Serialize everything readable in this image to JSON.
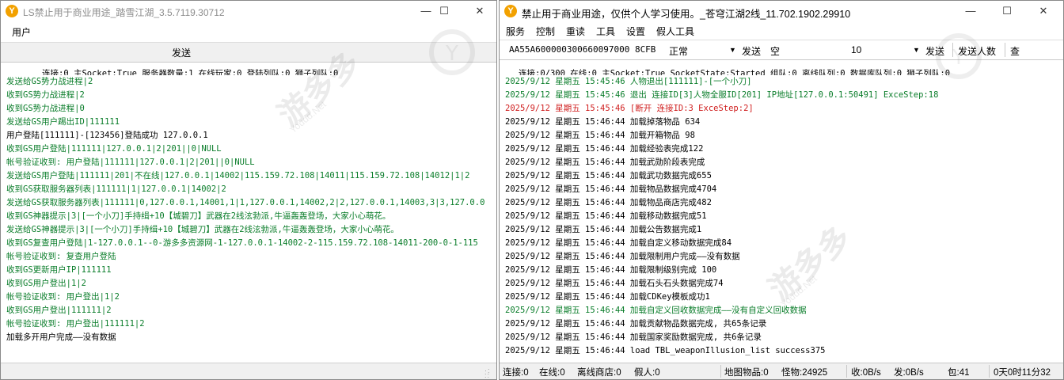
{
  "left": {
    "title": "LS禁止用于商业用途_踏雪江湖_3.5.7119.30712",
    "menu": [
      "用户"
    ],
    "send_label": "发送",
    "status": "连接:0   主Socket:True   服务器数量:1   在线玩家:0   登陆列队:0   狮子列队:0",
    "lines": [
      {
        "text": "发送给GS势力战进程|2",
        "color": "green"
      },
      {
        "text": "收到GS势力战进程|2",
        "color": "green"
      },
      {
        "text": "收到GS势力战进程|0",
        "color": "green"
      },
      {
        "text": "发送给GS用户踢出ID|111111",
        "color": "green"
      },
      {
        "text": "用户登陆[111111]-[123456]登陆成功  127.0.0.1",
        "color": "black"
      },
      {
        "text": "收到GS用户登陆|111111|127.0.0.1|2|201||0|NULL",
        "color": "green"
      },
      {
        "text": "帐号验证收到: 用户登陆|111111|127.0.0.1|2|201||0|NULL",
        "color": "green"
      },
      {
        "text": "发送给GS用户登陆|111111|201|不在线|127.0.0.1|14002|115.159.72.108|14011|115.159.72.108|14012|1|2",
        "color": "green"
      },
      {
        "text": "收到GS获取服务器列表|111111|1|127.0.0.1|14002|2",
        "color": "green"
      },
      {
        "text": "发送给GS获取服务器列表|111111|0,127.0.0.1,14001,1|1,127.0.0.1,14002,2|2,127.0.0.1,14003,3|3,127.0.0",
        "color": "green"
      },
      {
        "text": "收到GS神器提示|3|[一个小刀]手持缉+10【城碧刀】武器在2线泫勃派,牛逼轰轰登场，大家小心萌花。",
        "color": "green"
      },
      {
        "text": "发送给GS神器提示|3|[一个小刀]手持缉+10【城碧刀】武器在2线泫勃派,牛逼轰轰登场，大家小心萌花。",
        "color": "green"
      },
      {
        "text": "收到GS复查用户登陆|1-127.0.0.1--0-游多多资源网-1-127.0.0.1-14002-2-115.159.72.108-14011-200-0-1-115",
        "color": "green"
      },
      {
        "text": "帐号验证收到: 复查用户登陆",
        "color": "green"
      },
      {
        "text": "收到GS更新用户IP|111111",
        "color": "green"
      },
      {
        "text": "收到GS用户登出|1|2",
        "color": "green"
      },
      {
        "text": "帐号验证收到: 用户登出|1|2",
        "color": "green"
      },
      {
        "text": "收到GS用户登出|111111|2",
        "color": "green"
      },
      {
        "text": "帐号验证收到: 用户登出|111111|2",
        "color": "green"
      },
      {
        "text": "加载多开用户完成——没有数据",
        "color": "black"
      }
    ]
  },
  "right": {
    "title": "禁止用于商业用途，仅供个人学习使用。_苍穹江湖2线_11.702.1902.29910",
    "menu": [
      "服务",
      "控制",
      "重读",
      "工具",
      "设置",
      "假人工具"
    ],
    "toolbar": {
      "id_value": "AA55A600000300660097000 8CFB",
      "mode_value": "正常",
      "send_label": "发送",
      "input_value": "空",
      "count_value": "10",
      "send2_label": "发送",
      "send_count_label": "发送人数",
      "query_label": "查"
    },
    "status": "连接:0/300   在线:0   主Socket:True   SocketState:Started   组队:0   离线队列:0   数据库队列:0   狮子列队:0",
    "lines": [
      {
        "text": "2025/9/12 星期五 15:45:46 人物退出[111111]-[一个小刀]",
        "color": "green"
      },
      {
        "text": "2025/9/12 星期五 15:45:46 退出 连接ID[3]人物全服ID[201] IP地址[127.0.0.1:50491] ExceStep:18",
        "color": "green"
      },
      {
        "text": "2025/9/12 星期五 15:45:46 [断开 连接ID:3 ExceStep:2]",
        "color": "red"
      },
      {
        "text": "2025/9/12 星期五 15:46:44 加载掉落物品   634",
        "color": "black"
      },
      {
        "text": "2025/9/12 星期五 15:46:44 加载开箱物品   98",
        "color": "black"
      },
      {
        "text": "2025/9/12 星期五 15:46:44 加载经验表完成122",
        "color": "black"
      },
      {
        "text": "2025/9/12 星期五 15:46:44 加载武勋阶段表完成",
        "color": "black"
      },
      {
        "text": "2025/9/12 星期五 15:46:44 加载武功数据完成655",
        "color": "black"
      },
      {
        "text": "2025/9/12 星期五 15:46:44 加载物品数据完成4704",
        "color": "black"
      },
      {
        "text": "2025/9/12 星期五 15:46:44 加载物品商店完成482",
        "color": "black"
      },
      {
        "text": "2025/9/12 星期五 15:46:44 加载移动数据完成51",
        "color": "black"
      },
      {
        "text": "2025/9/12 星期五 15:46:44 加载公告数据完成1",
        "color": "black"
      },
      {
        "text": "2025/9/12 星期五 15:46:44 加载自定义移动数据完成84",
        "color": "black"
      },
      {
        "text": "2025/9/12 星期五 15:46:44 加载限制用户完成——没有数据",
        "color": "black"
      },
      {
        "text": "2025/9/12 星期五 15:46:44 加载限制级别完成   100",
        "color": "black"
      },
      {
        "text": "2025/9/12 星期五 15:46:44 加载石头石头数据完成74",
        "color": "black"
      },
      {
        "text": "2025/9/12 星期五 15:46:44 加载CDKey模板成功1",
        "color": "black"
      },
      {
        "text": "2025/9/12 星期五 15:46:44 加载自定义回收数据完成——没有自定义回收数据",
        "color": "green"
      },
      {
        "text": "2025/9/12 星期五 15:46:44 加载贡献物品数据完成, 共65条记录",
        "color": "black"
      },
      {
        "text": "2025/9/12 星期五 15:46:44 加载国家奖励数据完成, 共6条记录",
        "color": "black"
      },
      {
        "text": "2025/9/12 星期五 15:46:44 load TBL_weaponIllusion_list success375",
        "color": "black"
      }
    ],
    "statusbar": {
      "conn": "连接:0",
      "online": "在线:0",
      "offline_shop": "离线商店:0",
      "fake": "假人:0",
      "map_items": "地图物品:0",
      "monsters": "怪物:24925",
      "recv": "收:0B/s",
      "sent": "发:0B/s",
      "packets": "包:41",
      "uptime": "0天0时11分32"
    }
  },
  "watermark_text": "游多多",
  "watermark_sub": "Youdd.Net"
}
